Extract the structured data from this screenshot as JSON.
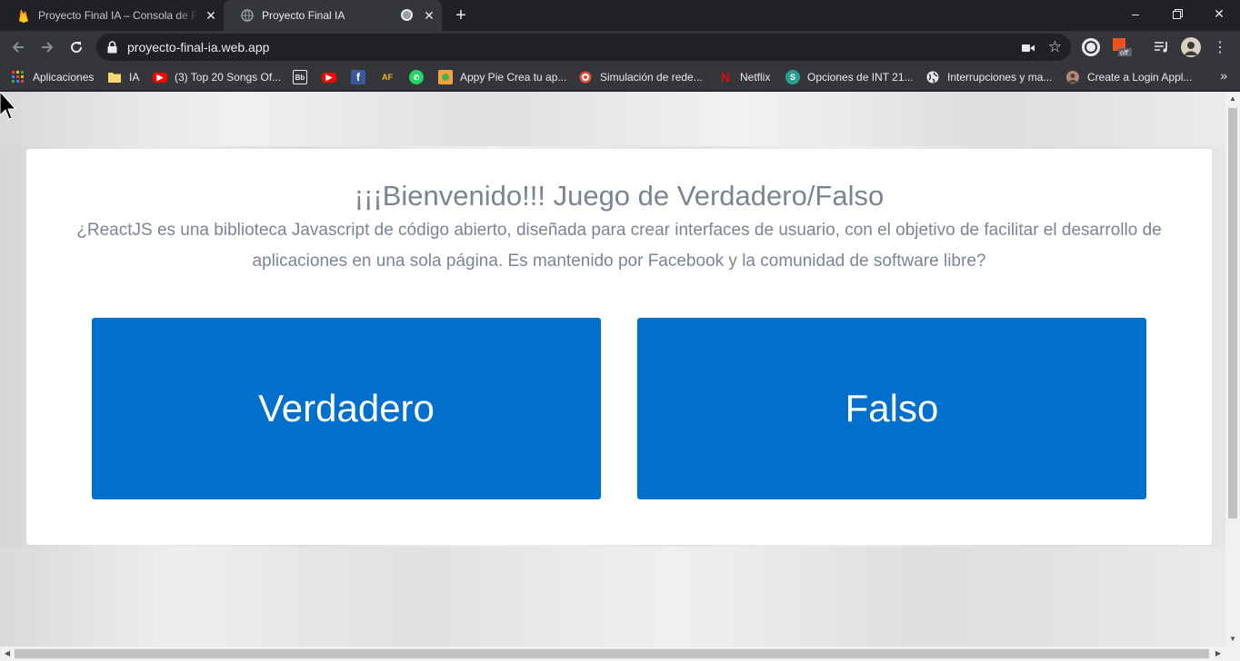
{
  "browser": {
    "tabs": [
      {
        "title": "Proyecto Final IA – Consola de Firebase",
        "icon": "firebase-icon",
        "active": false
      },
      {
        "title": "Proyecto Final IA",
        "icon": "globe-icon",
        "active": true
      }
    ],
    "url": "proyecto-final-ia.web.app"
  },
  "bookmarks": [
    {
      "label": "Aplicaciones",
      "icon": "apps-grid-icon"
    },
    {
      "label": "IA",
      "icon": "folder-icon"
    },
    {
      "label": "(3) Top 20 Songs Of...",
      "icon": "youtube-icon"
    },
    {
      "label": "",
      "icon": "bb-icon"
    },
    {
      "label": "",
      "icon": "youtube-icon"
    },
    {
      "label": "",
      "icon": "facebook-icon"
    },
    {
      "label": "",
      "icon": "af-icon"
    },
    {
      "label": "",
      "icon": "whatsapp-icon"
    },
    {
      "label": "Appy Pie Crea tu ap...",
      "icon": "appypie-icon"
    },
    {
      "label": "Simulación de rede...",
      "icon": "target-icon"
    },
    {
      "label": "Netflix",
      "icon": "netflix-icon"
    },
    {
      "label": "Opciones de INT 21...",
      "icon": "s-icon"
    },
    {
      "label": "Interrupciones y ma...",
      "icon": "globe-icon"
    },
    {
      "label": "Create a Login Appl...",
      "icon": "avatar-icon"
    }
  ],
  "page": {
    "title": "¡¡¡Bienvenido!!! Juego de Verdadero/Falso",
    "question": "¿ReactJS es una biblioteca Javascript de código abierto, diseñada para crear interfaces de usuario, con el objetivo de facilitar el desarrollo de aplicaciones en una sola página. Es mantenido por Facebook y la comunidad de software libre?",
    "true_label": "Verdadero",
    "false_label": "Falso"
  },
  "colors": {
    "button": "#0070cc",
    "text": "#7b8591",
    "chrome_dark": "#202124",
    "chrome_toolbar": "#35363a"
  }
}
